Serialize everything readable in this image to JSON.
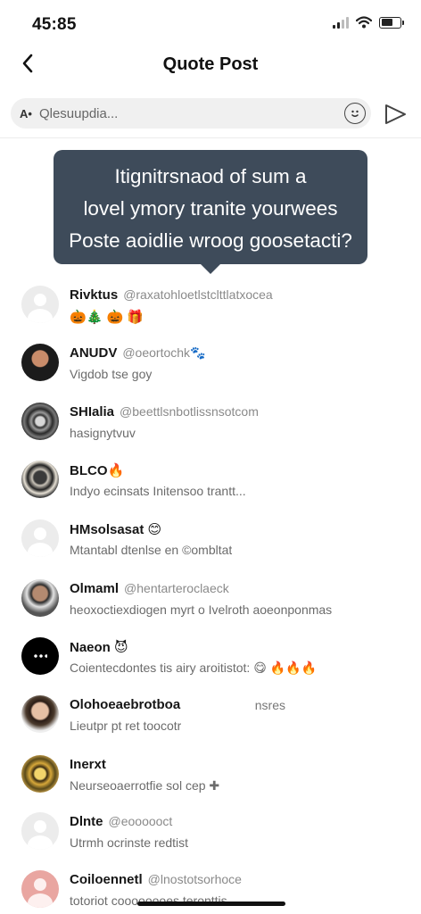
{
  "status_bar": {
    "time": "45:85",
    "battery_level": 0.6
  },
  "header": {
    "back_icon": "chevron-left-icon",
    "title": "Quote Post"
  },
  "compose": {
    "lead": "A•",
    "placeholder": "Qlesuupdia...",
    "emoji_icon": "smiley-icon",
    "send_icon": "send-icon"
  },
  "tooltip": {
    "lines": [
      "Itignitrsnaod of sum a",
      "lovel ymory tranite yourwees",
      "Poste aoidlie wroog goosetacti?"
    ]
  },
  "contacts": [
    {
      "name": "Rivktus",
      "handle": "@raxatohloetlstclttlatxocea",
      "meta": "",
      "sub": "🎃🎄 🎃 🎁",
      "avatar": "placeholder"
    },
    {
      "name": "ANUDV",
      "handle": "@oeortochk🐾",
      "meta": "",
      "sub": "Vigdob tse goy",
      "avatar": "photo-1"
    },
    {
      "name": "SHIalia",
      "handle": "@beettlsnbotlissnsotcom",
      "meta": "",
      "sub": "hasignytvuv",
      "avatar": "photo-2"
    },
    {
      "name": "BLCO🔥",
      "handle": "",
      "meta": "",
      "sub": "Indyo ecinsats Initensoo trantt...",
      "avatar": "photo-3"
    },
    {
      "name": "HMsolsasat 😊",
      "handle": "",
      "meta": "",
      "sub": "Mtantabl dtenlse en ©ombltat",
      "avatar": "placeholder"
    },
    {
      "name": "Olmaml",
      "handle": "@hentarteroclaeck",
      "meta": "",
      "sub": "heoxoctiexdiogen myrt o Ivelroth aoeonponmas",
      "avatar": "photo-4"
    },
    {
      "name": "Naeon 😈",
      "handle": "",
      "meta": "",
      "sub": "Coientecdontes tis airy aroitistot: 😋 🔥🔥🔥",
      "avatar": "photo-5"
    },
    {
      "name": "Olohoeaebrotboa",
      "handle": "",
      "meta": "nsres",
      "sub": "Lieutpr pt ret toocotr",
      "avatar": "photo-6"
    },
    {
      "name": "Inerxt",
      "handle": "",
      "meta": "",
      "sub": "Neurseoaerrotfie sol cep ✚",
      "avatar": "photo-7"
    },
    {
      "name": "Dlnte",
      "handle": "@eoooooct",
      "meta": "",
      "sub": "Utrmh ocrinste redtist",
      "avatar": "placeholder"
    },
    {
      "name": "Coiloennetl",
      "handle": "@lnostotsorhoce",
      "meta": "",
      "sub": "totoriot coooooooes teronttis",
      "avatar": "pink"
    }
  ]
}
